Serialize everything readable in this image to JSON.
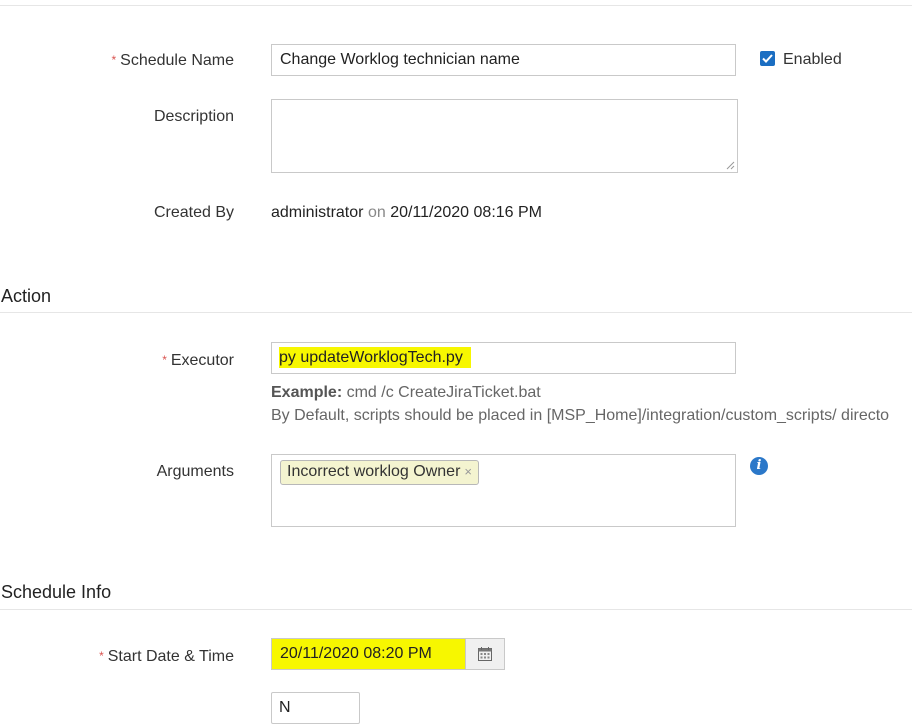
{
  "form": {
    "schedule_name": {
      "label": "Schedule Name",
      "value": "Change Worklog technician name"
    },
    "enabled": {
      "label": "Enabled",
      "checked": true
    },
    "description": {
      "label": "Description",
      "value": ""
    },
    "created_by": {
      "label": "Created By",
      "user": "administrator",
      "on": "on",
      "timestamp": "20/11/2020 08:16 PM"
    }
  },
  "action": {
    "title": "Action",
    "executor": {
      "label": "Executor",
      "value": "py updateWorklogTech.py"
    },
    "example_label": "Example:",
    "example_value": "cmd /c CreateJiraTicket.bat",
    "default_note": "By Default, scripts should be placed in [MSP_Home]/integration/custom_scripts/ directo",
    "arguments": {
      "label": "Arguments",
      "tags": [
        "Incorrect worklog Owner"
      ]
    }
  },
  "schedule_info": {
    "title": "Schedule Info",
    "start": {
      "label": "Start Date & Time",
      "value": "20/11/2020 08:20 PM"
    },
    "partial_select_value": "N"
  },
  "required_marker": "*",
  "icons": {
    "info": "i",
    "calendar": "calendar-icon",
    "remove": "×"
  },
  "colors": {
    "highlight": "#f7f700",
    "required": "#d9534f",
    "checkbox": "#1b6ec2",
    "info": "#2b78c9"
  }
}
